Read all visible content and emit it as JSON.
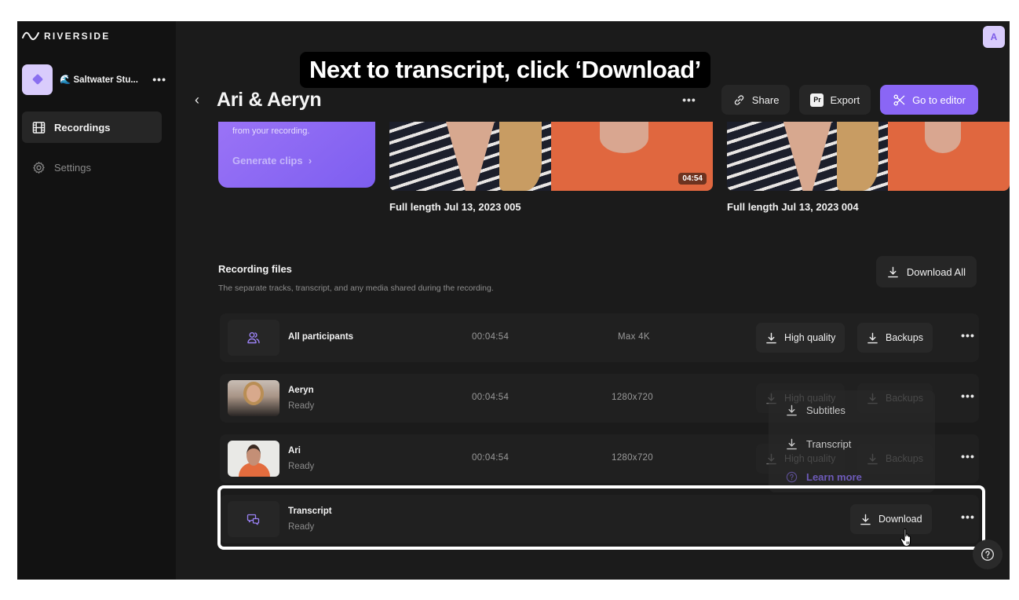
{
  "brand": {
    "name": "RIVERSIDE"
  },
  "workspace": {
    "name": "🌊 Saltwater Stu...",
    "more": "•••"
  },
  "sidebar": {
    "items": [
      {
        "label": "Recordings",
        "icon": "film-icon",
        "active": true
      },
      {
        "label": "Settings",
        "icon": "gear-icon",
        "active": false
      }
    ]
  },
  "profile": {
    "initial": "A"
  },
  "instruction": "Next to transcript, click ‘Download’",
  "header": {
    "title": "Ari & Aeryn",
    "more": "•••",
    "share_label": "Share",
    "export_badge": "Pr",
    "export_label": "Export",
    "editor_label": "Go to editor"
  },
  "colors": {
    "accent": "#8a66f5",
    "accent_light": "#d9ccfc",
    "background": "#1b1b1b",
    "sidebar": "#121212"
  },
  "clips_card": {
    "text": "from your recording.",
    "link": "Generate clips"
  },
  "recordings": [
    {
      "label": "Full length Jul 13, 2023 005",
      "duration": "04:54"
    },
    {
      "label": "Full length Jul 13, 2023 004",
      "duration": ""
    }
  ],
  "recording_files": {
    "title": "Recording files",
    "subtitle": "The separate tracks, transcript, and any media shared during the recording.",
    "download_all": "Download All",
    "rows": [
      {
        "name": "All participants",
        "status": "",
        "duration": "00:04:54",
        "resolution": "Max 4K",
        "actions": [
          "High quality",
          "Backups"
        ]
      },
      {
        "name": "Aeryn",
        "status": "Ready",
        "duration": "00:04:54",
        "resolution": "1280x720",
        "actions": [
          "High quality",
          "Backups"
        ]
      },
      {
        "name": "Ari",
        "status": "Ready",
        "duration": "00:04:54",
        "resolution": "1280x720",
        "actions": [
          "High quality",
          "Backups"
        ]
      },
      {
        "name": "Transcript",
        "status": "Ready",
        "duration": "",
        "resolution": "",
        "actions": [
          "Download"
        ]
      }
    ],
    "more": "•••"
  },
  "transcript_menu": {
    "items": [
      "Subtitles",
      "Transcript"
    ],
    "learn_more": "Learn more"
  }
}
